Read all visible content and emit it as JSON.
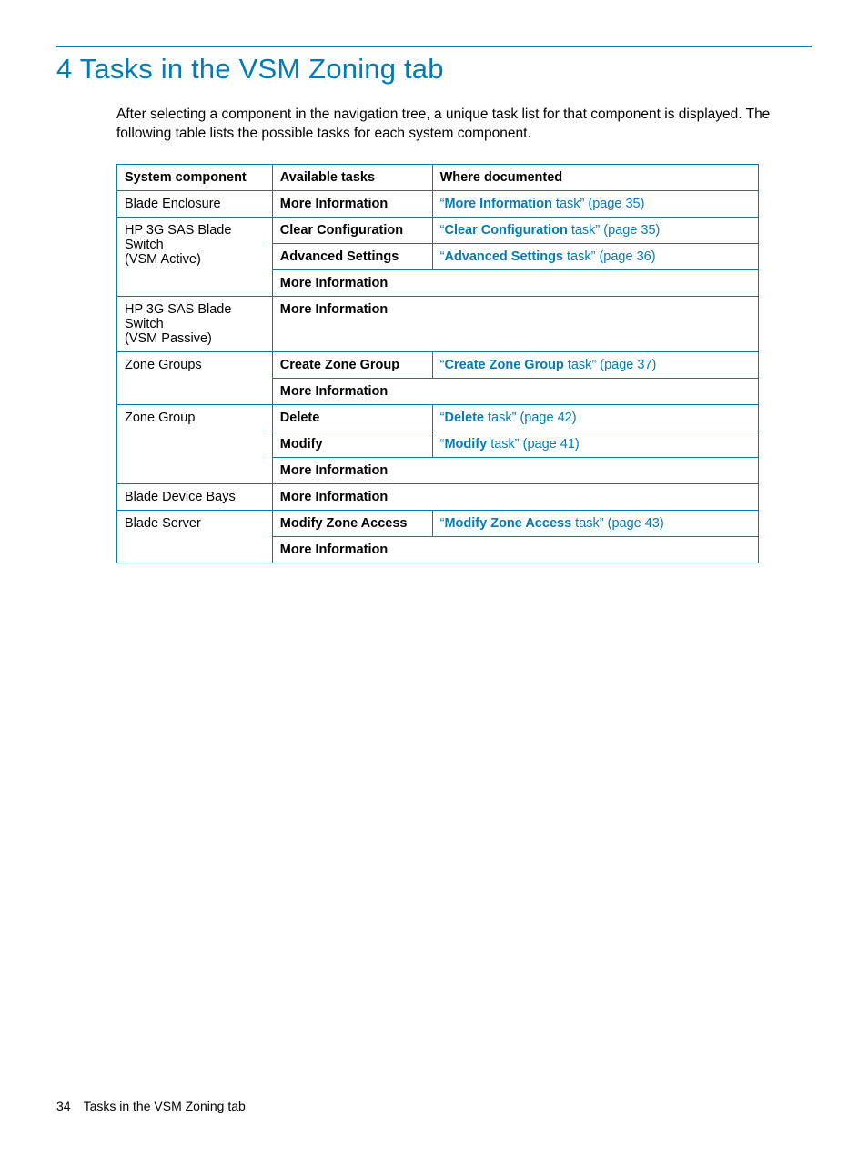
{
  "title": "4 Tasks in the VSM Zoning tab",
  "intro": "After selecting a component in the navigation tree, a unique task list for that component is displayed. The following table lists the possible tasks for each system component.",
  "headers": {
    "c1": "System component",
    "c2": "Available tasks",
    "c3": "Where documented"
  },
  "rows": {
    "blade_enclosure": {
      "component": "Blade Enclosure",
      "task": "More Information",
      "doc_q1": "“",
      "doc_bold": "More Information",
      "doc_rest": " task” (page 35)"
    },
    "active": {
      "component_l1": "HP 3G SAS Blade Switch",
      "component_l2": "(VSM Active)",
      "r1_task": "Clear Configuration",
      "r1_q1": "“",
      "r1_bold": "Clear Configuration",
      "r1_rest": " task” (page 35)",
      "r2_task": "Advanced Settings",
      "r2_q1": "“",
      "r2_bold": "Advanced Settings",
      "r2_rest": " task” (page 36)",
      "r3_task": "More Information"
    },
    "passive": {
      "component_l1": "HP 3G SAS Blade Switch",
      "component_l2": "(VSM Passive)",
      "task": "More Information"
    },
    "zone_groups": {
      "component": "Zone Groups",
      "r1_task": "Create Zone Group",
      "r1_q1": "“",
      "r1_bold": "Create Zone Group",
      "r1_rest": " task” (page 37)",
      "r2_task": "More Information"
    },
    "zone_group": {
      "component": "Zone Group",
      "r1_task": "Delete",
      "r1_q1": "“",
      "r1_bold": "Delete",
      "r1_rest": " task” (page 42)",
      "r2_task": "Modify",
      "r2_q1": "“",
      "r2_bold": "Modify",
      "r2_rest": " task” (page 41)",
      "r3_task": "More Information"
    },
    "blade_device_bays": {
      "component": "Blade Device Bays",
      "task": "More Information"
    },
    "blade_server": {
      "component": "Blade Server",
      "r1_task": "Modify Zone Access",
      "r1_q1": "“",
      "r1_bold": "Modify Zone Access",
      "r1_rest": " task” (page 43)",
      "r2_task": "More Information"
    }
  },
  "footer": {
    "page": "34",
    "text": "Tasks in the VSM Zoning tab"
  }
}
